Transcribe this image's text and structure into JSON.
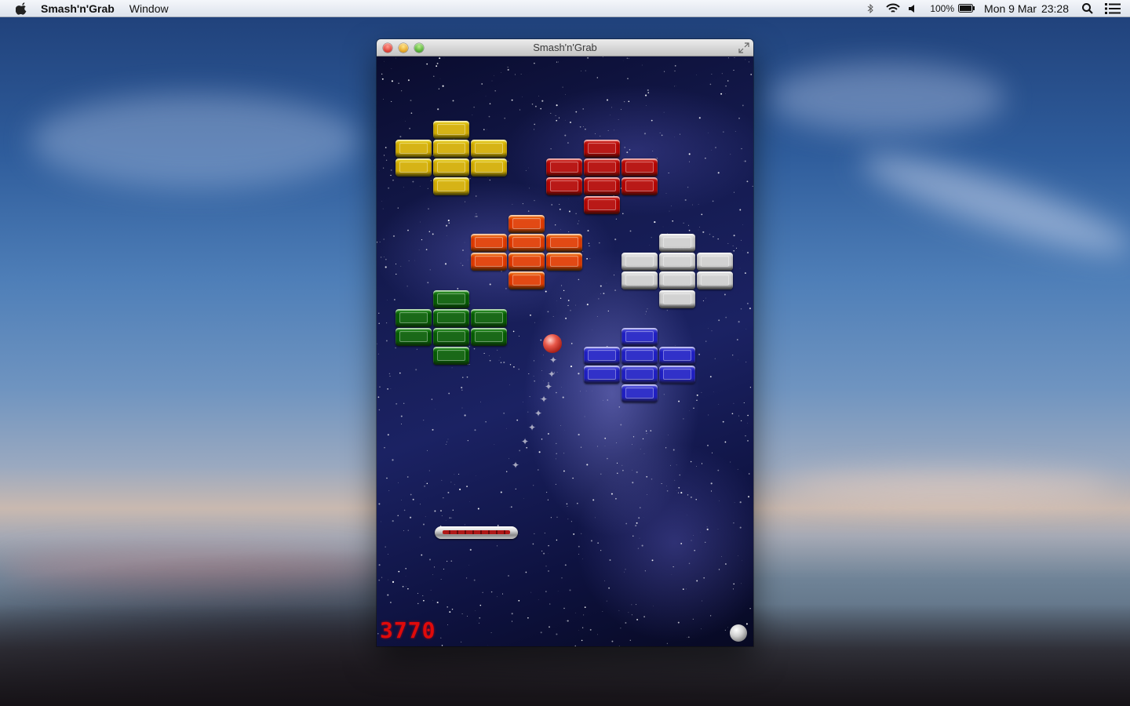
{
  "menubar": {
    "app_name": "Smash'n'Grab",
    "menus": [
      "Window"
    ],
    "battery": "100%",
    "date": "Mon 9 Mar",
    "time": "23:28"
  },
  "window": {
    "title": "Smash'n'Grab"
  },
  "game": {
    "score": "3770",
    "brick_groups": [
      {
        "name": "yellow",
        "color": "#e8d21a"
      },
      {
        "name": "red",
        "color": "#d6271f"
      },
      {
        "name": "orange",
        "color": "#ef7a12"
      },
      {
        "name": "white",
        "color": "#e6e6e6"
      },
      {
        "name": "green",
        "color": "#2a9a22"
      },
      {
        "name": "blue",
        "color": "#5a5ae0"
      }
    ],
    "lives_remaining": 1
  }
}
